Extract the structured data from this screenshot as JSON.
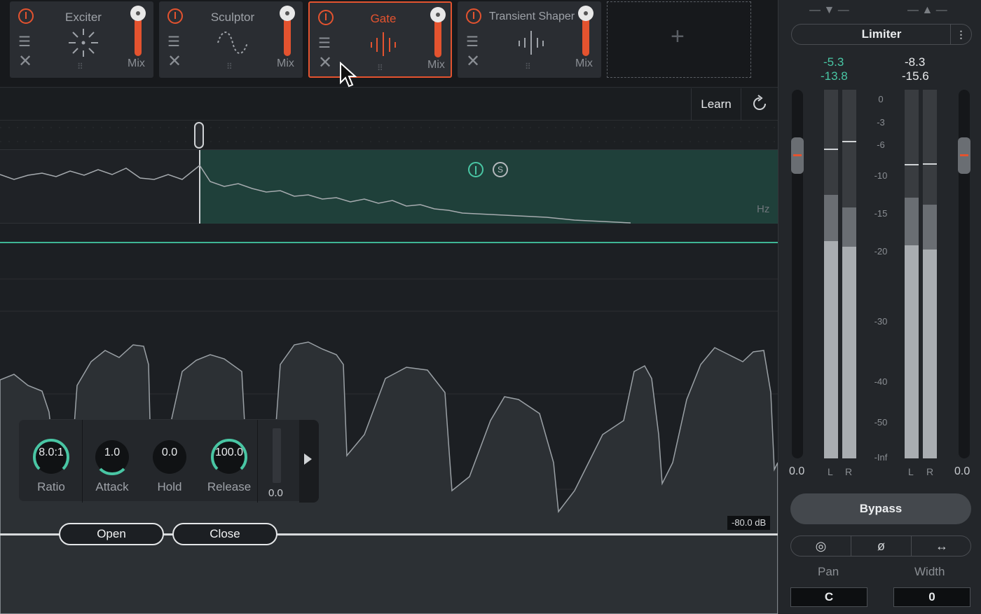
{
  "modules": [
    {
      "name": "Exciter",
      "mix_label": "Mix"
    },
    {
      "name": "Sculptor",
      "mix_label": "Mix"
    },
    {
      "name": "Gate",
      "mix_label": "Mix",
      "active": true
    },
    {
      "name": "Transient Shaper",
      "mix_label": "Mix"
    }
  ],
  "add_module_symbol": "+",
  "toolbar": {
    "learn_label": "Learn"
  },
  "spectrum": {
    "unit_label": "Hz",
    "solo_label": "S"
  },
  "meter_floor_label": "-80.0 dB",
  "gate_knobs": [
    {
      "value": "8.0:1",
      "label": "Ratio"
    },
    {
      "value": "1.0",
      "label": "Attack"
    },
    {
      "value": "0.0",
      "label": "Hold"
    },
    {
      "value": "100.0",
      "label": "Release"
    }
  ],
  "mini_meter_value": "0.0",
  "envelope": {
    "open_label": "Open",
    "close_label": "Close"
  },
  "right_panel": {
    "module_name": "Limiter",
    "in_peak": "-5.3",
    "in_rms": "-13.8",
    "out_peak": "-8.3",
    "out_rms": "-15.6",
    "scale": [
      "0",
      "-3",
      "-6",
      "-10",
      "-15",
      "-20",
      "-30",
      "-40",
      "-50",
      "-Inf"
    ],
    "in_gain": "0.0",
    "out_gain": "0.0",
    "channel_labels": [
      "L",
      "R",
      "L",
      "R"
    ],
    "bypass_label": "Bypass",
    "pan_label": "Pan",
    "width_label": "Width",
    "pan_value": "C",
    "width_value": "0"
  },
  "colors": {
    "accent": "#e4532f",
    "teal": "#49c6a4"
  }
}
